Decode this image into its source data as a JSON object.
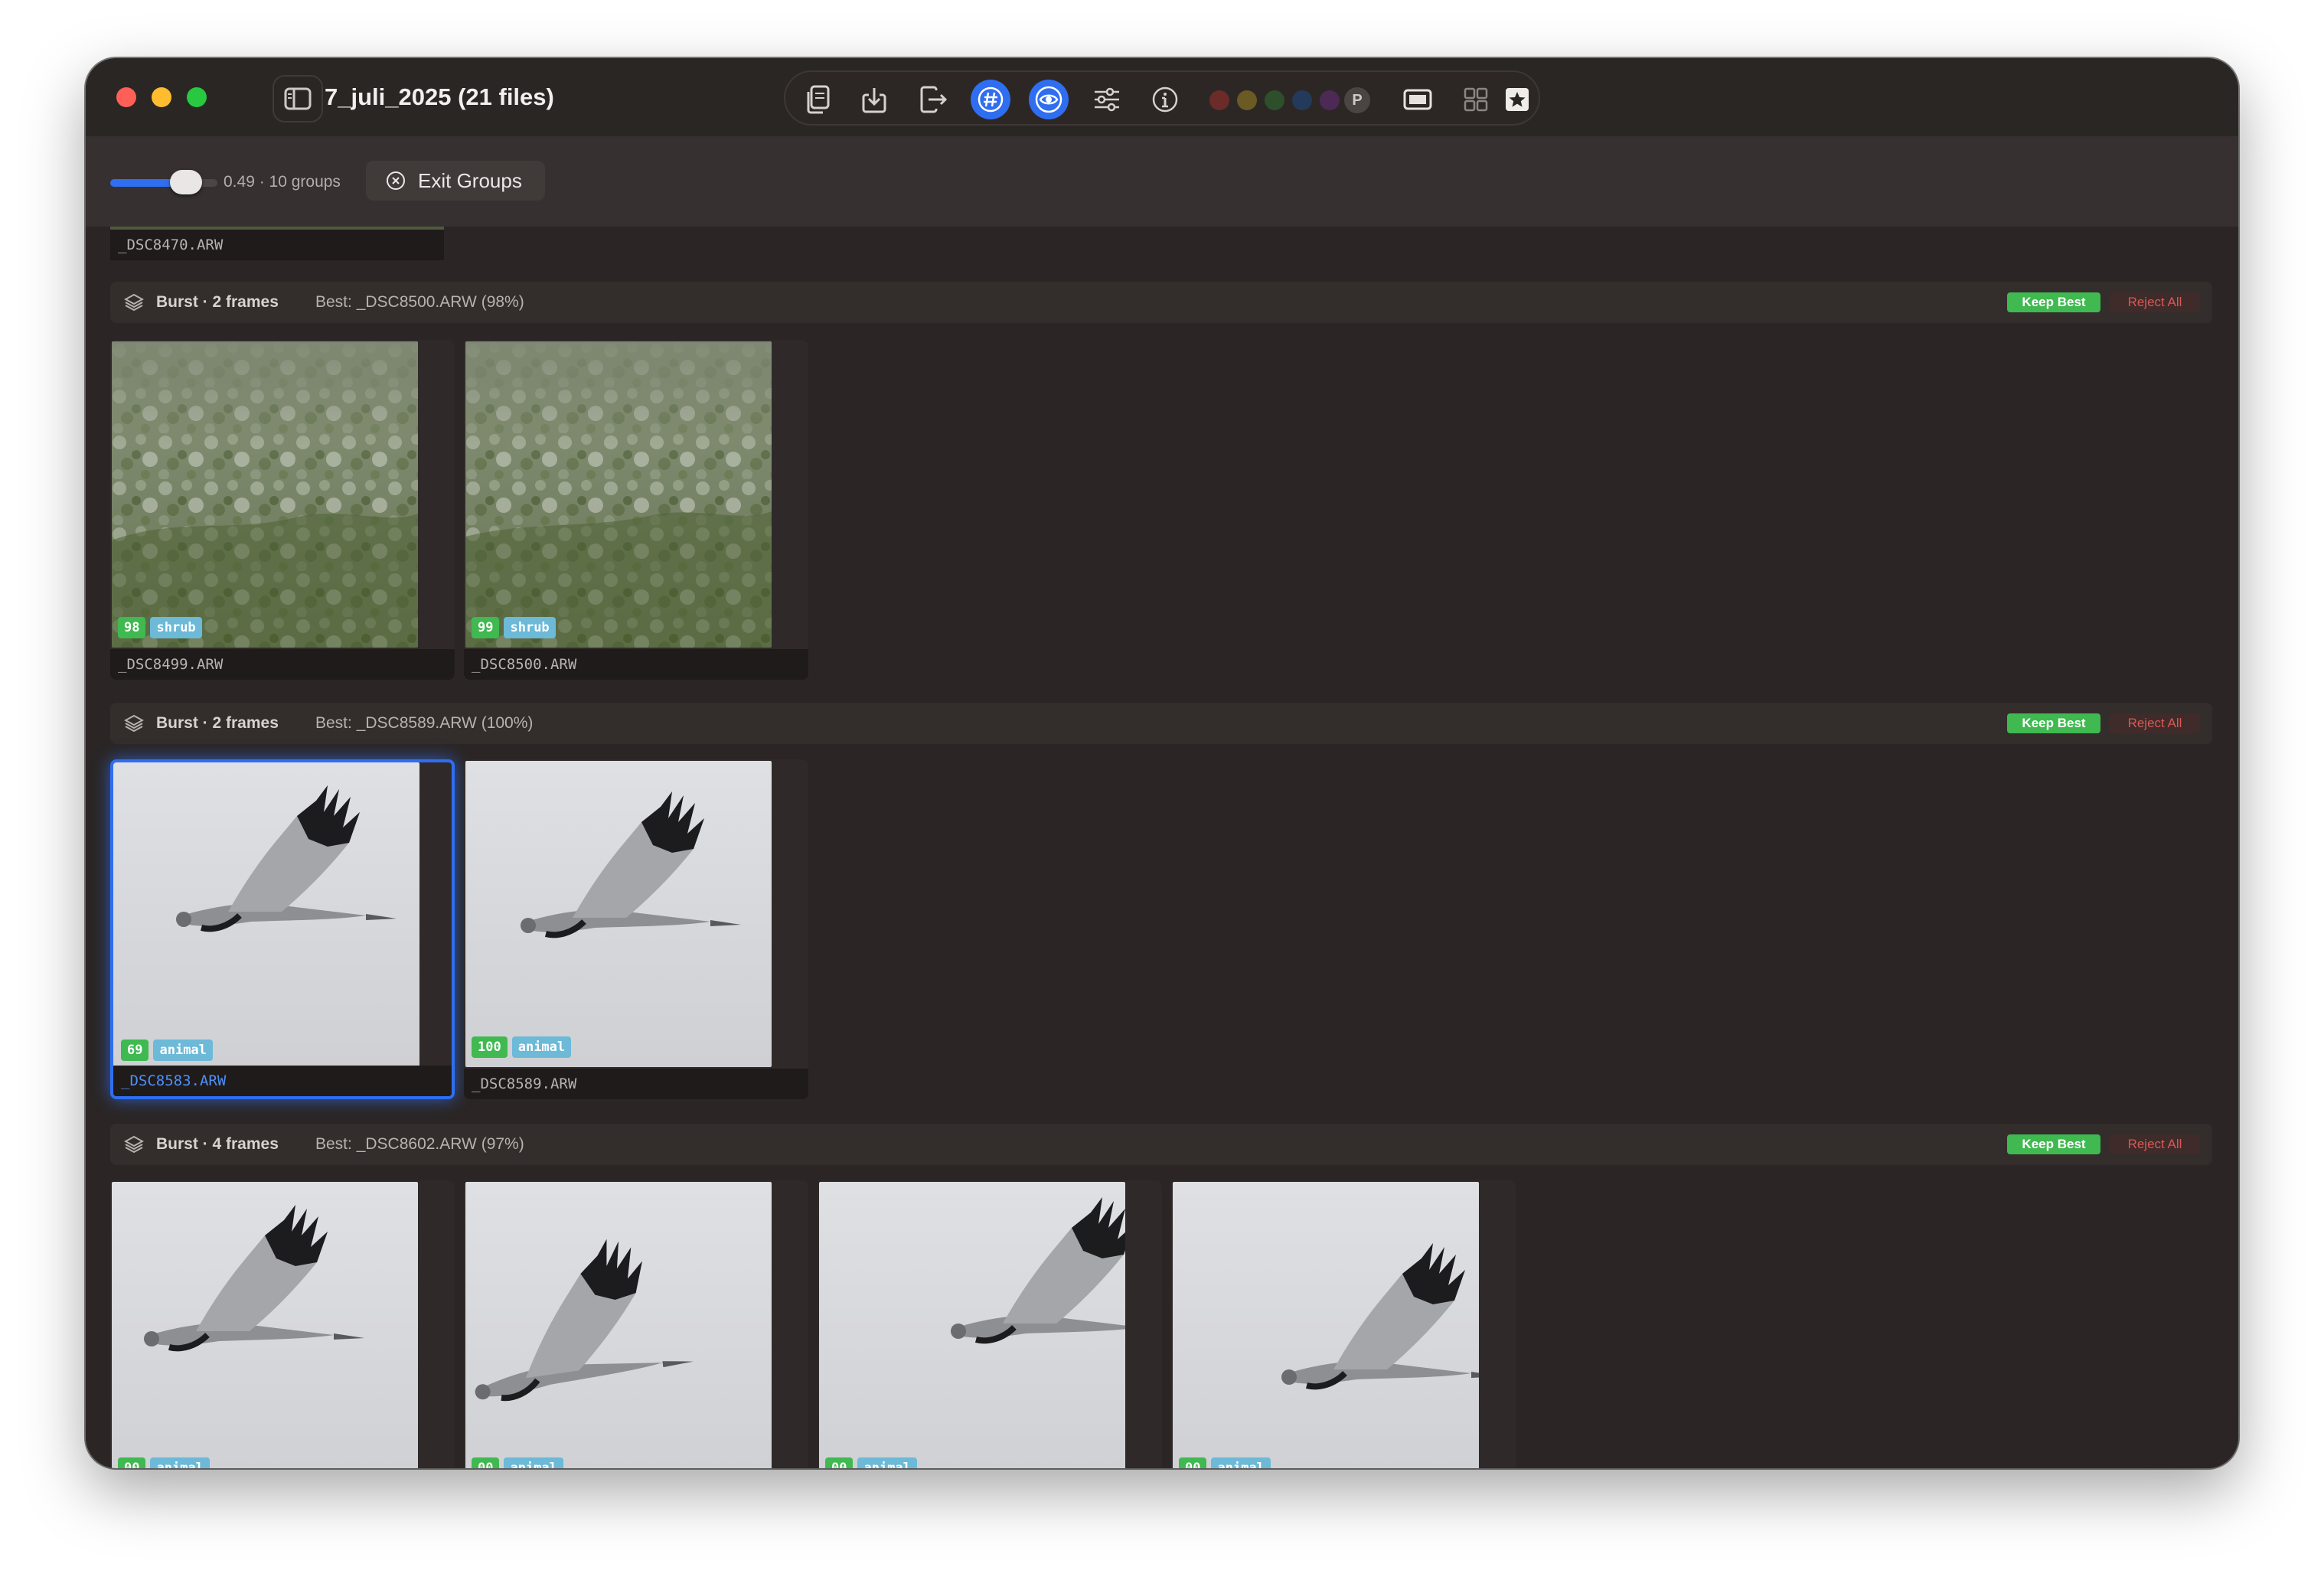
{
  "window": {
    "title": "7_juli_2025 (21 files)"
  },
  "toolbar": {
    "icons": [
      "copy-icon",
      "import-icon",
      "export-icon",
      "hashtag-icon",
      "eye-icon",
      "sliders-icon",
      "info-icon"
    ],
    "color_labels": [
      "#6b2b28",
      "#6a5a23",
      "#2d4f2c",
      "#243a5a",
      "#4d2a55"
    ],
    "p_label": "P",
    "view_icons": [
      "single-view-icon",
      "grid-view-icon",
      "star-icon"
    ]
  },
  "subbar": {
    "slider_value": 0.49,
    "slider_text": "0.49 · 10 groups",
    "exit_label": "Exit Groups"
  },
  "colors": {
    "accent": "#2f6ef0",
    "keep": "#3fb950",
    "reject": "#d85a55",
    "tag": "#6cb9d8"
  },
  "partial_file": "_DSC8470.ARW",
  "groups": [
    {
      "title": "Burst · 2 frames",
      "best": "Best: _DSC8500.ARW (98%)",
      "keep_label": "Keep Best",
      "reject_label": "Reject All",
      "frames": [
        {
          "file": "_DSC8499.ARW",
          "score": "98",
          "tag": "shrub"
        },
        {
          "file": "_DSC8500.ARW",
          "score": "99",
          "tag": "shrub"
        }
      ]
    },
    {
      "title": "Burst · 2 frames",
      "best": "Best: _DSC8589.ARW (100%)",
      "keep_label": "Keep Best",
      "reject_label": "Reject All",
      "frames": [
        {
          "file": "_DSC8583.ARW",
          "score": "69",
          "tag": "animal",
          "selected": true
        },
        {
          "file": "_DSC8589.ARW",
          "score": "100",
          "tag": "animal"
        }
      ]
    },
    {
      "title": "Burst · 4 frames",
      "best": "Best: _DSC8602.ARW (97%)",
      "keep_label": "Keep Best",
      "reject_label": "Reject All",
      "frames": [
        {
          "file": "",
          "score": "",
          "tag": ""
        },
        {
          "file": "",
          "score": "",
          "tag": ""
        },
        {
          "file": "",
          "score": "",
          "tag": ""
        },
        {
          "file": "",
          "score": "",
          "tag": ""
        }
      ]
    }
  ]
}
